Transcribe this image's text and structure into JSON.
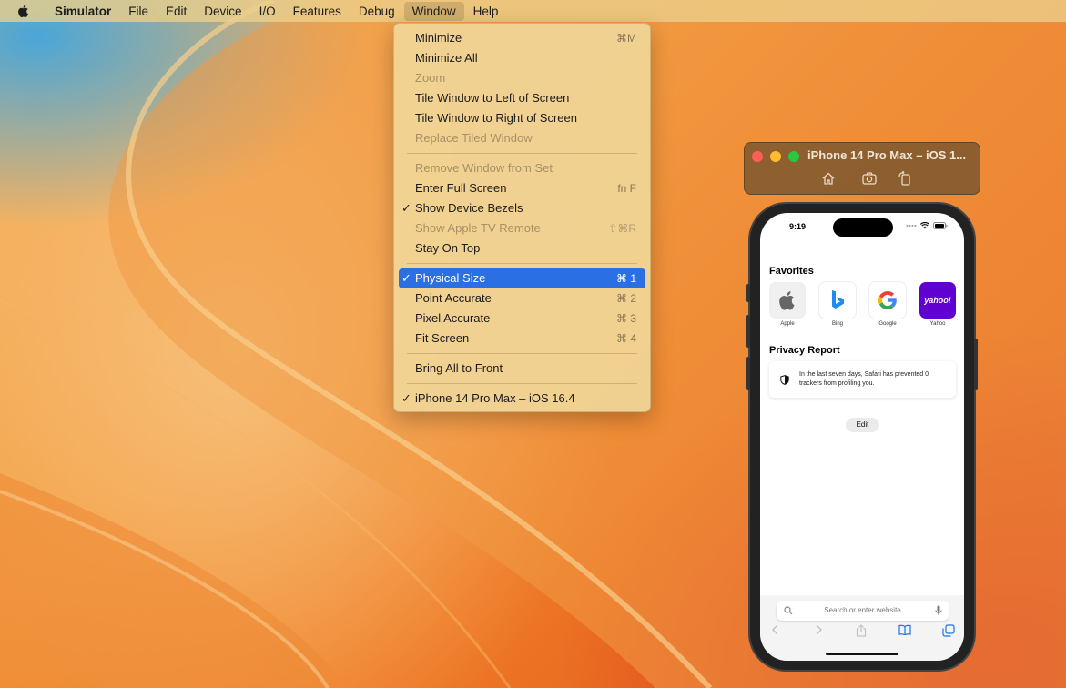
{
  "menubar": {
    "apple_icon": "apple-logo-icon",
    "items": [
      "Simulator",
      "File",
      "Edit",
      "Device",
      "I/O",
      "Features",
      "Debug",
      "Window",
      "Help"
    ],
    "active": "Window"
  },
  "window_menu": {
    "items": [
      {
        "label": "Minimize",
        "shortcut": "⌘M",
        "enabled": true
      },
      {
        "label": "Minimize All",
        "shortcut": "",
        "enabled": true
      },
      {
        "label": "Zoom",
        "shortcut": "",
        "enabled": false
      },
      {
        "label": "Tile Window to Left of Screen",
        "shortcut": "",
        "enabled": true
      },
      {
        "label": "Tile Window to Right of Screen",
        "shortcut": "",
        "enabled": true
      },
      {
        "label": "Replace Tiled Window",
        "shortcut": "",
        "enabled": false
      },
      {
        "separator": true
      },
      {
        "label": "Remove Window from Set",
        "shortcut": "",
        "enabled": false
      },
      {
        "label": "Enter Full Screen",
        "shortcut": "fn F",
        "enabled": true
      },
      {
        "label": "Show Device Bezels",
        "shortcut": "",
        "enabled": true,
        "checked": true
      },
      {
        "label": "Show Apple TV Remote",
        "shortcut": "⇧⌘R",
        "enabled": false
      },
      {
        "label": "Stay On Top",
        "shortcut": "",
        "enabled": true
      },
      {
        "separator": true
      },
      {
        "label": "Physical Size",
        "shortcut": "⌘ 1",
        "enabled": true,
        "checked": true,
        "selected": true
      },
      {
        "label": "Point Accurate",
        "shortcut": "⌘ 2",
        "enabled": true
      },
      {
        "label": "Pixel Accurate",
        "shortcut": "⌘ 3",
        "enabled": true
      },
      {
        "label": "Fit Screen",
        "shortcut": "⌘ 4",
        "enabled": true
      },
      {
        "separator": true
      },
      {
        "label": "Bring All to Front",
        "shortcut": "",
        "enabled": true
      },
      {
        "separator": true
      },
      {
        "label": "iPhone 14 Pro Max – iOS 16.4",
        "shortcut": "",
        "enabled": true,
        "checked": true
      }
    ]
  },
  "simulator_window": {
    "title": "iPhone 14 Pro Max – iOS 1...",
    "toolbar": [
      "home-icon",
      "screenshot-icon",
      "rotate-icon"
    ]
  },
  "phone": {
    "status_time": "9:19",
    "favorites_title": "Favorites",
    "favorites": [
      {
        "label": "Apple",
        "icon": "apple-logo-icon"
      },
      {
        "label": "Bing",
        "icon": "bing-logo-icon"
      },
      {
        "label": "Google",
        "icon": "google-logo-icon"
      },
      {
        "label": "Yahoo",
        "icon": "yahoo-logo-icon",
        "logo_text": "yahoo!"
      }
    ],
    "privacy_title": "Privacy Report",
    "privacy_text": "In the last seven days, Safari has prevented 0 trackers from profiling you.",
    "edit_label": "Edit",
    "search_placeholder": "Search or enter website"
  },
  "colors": {
    "menu_highlight": "#2a6fe3",
    "yahoo_purple": "#6001d2",
    "bing_blue": "#1d8bf0"
  }
}
